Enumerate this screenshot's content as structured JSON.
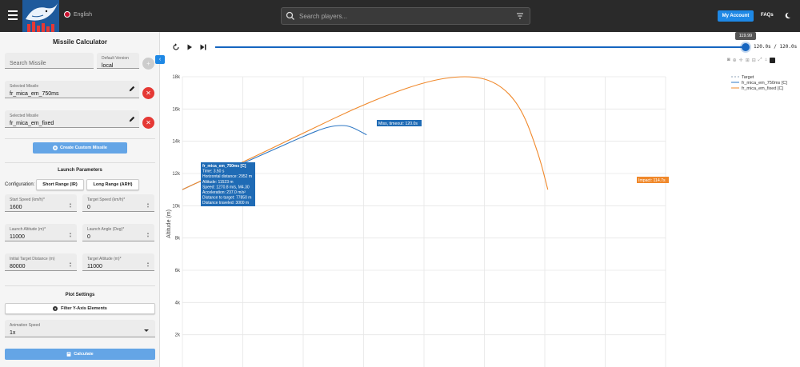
{
  "header": {
    "language": "English",
    "search_placeholder": "Search players...",
    "account_label": "My Account",
    "faqs_label": "FAQs",
    "icons": [
      "menu-icon",
      "flag-icon",
      "search-icon",
      "filter-icon",
      "moon-icon"
    ]
  },
  "sidebar": {
    "title": "Missile Calculator",
    "search_missile_placeholder": "Search Missile",
    "default_version_label": "Default Version",
    "default_version_value": "local",
    "selected_missile_label": "Selected Missile",
    "selected_missile_1": "fr_mica_em_750ms",
    "selected_missile_2": "fr_mica_em_fixed",
    "create_custom_label": "Create Custom Missile",
    "launch_params_title": "Launch Parameters",
    "configuration_label": "Configuration:",
    "short_range_label": "Short Range (IR)",
    "long_range_label": "Long Range (ARH)",
    "start_speed_label": "Start Speed (km/h)*",
    "start_speed_value": "1600",
    "target_speed_label": "Target Speed (km/h)*",
    "target_speed_value": "0",
    "launch_altitude_label": "Launch Altitude (m)*",
    "launch_altitude_value": "11000",
    "launch_angle_label": "Launch Angle (Deg)*",
    "launch_angle_value": "0",
    "initial_distance_label": "Initial Target Distance (m)",
    "initial_distance_value": "80000",
    "target_altitude_label": "Target Altitude (m)*",
    "target_altitude_value": "11000",
    "plot_settings_title": "Plot Settings",
    "filter_label": "Filter Y-Axis Elements",
    "animation_speed_label": "Animation Speed",
    "animation_speed_value": "1x",
    "calculate_label": "Calculate"
  },
  "player": {
    "tooltip": "119.99",
    "time_readout": "120.0s / 120.0s",
    "progress": 1.0
  },
  "chart_data": {
    "type": "line",
    "ylabel": "Altitude (m)",
    "xlabel": "",
    "ylim": [
      0,
      18000
    ],
    "xlim": [
      0,
      80000
    ],
    "y_ticks": [
      "2k",
      "4k",
      "6k",
      "8k",
      "10k",
      "12k",
      "14k",
      "16k",
      "18k"
    ],
    "y_tick_values": [
      2000,
      4000,
      6000,
      8000,
      10000,
      12000,
      14000,
      16000,
      18000
    ],
    "grid": true,
    "legend_position": "top-right",
    "series": [
      {
        "name": "Target",
        "color": "#8fa3b8",
        "dashed": true,
        "x": [],
        "y": []
      },
      {
        "name": "fr_mica_em_750ms [C]",
        "color": "#2f78c4",
        "x": [
          0,
          2952,
          8000,
          14000,
          20000,
          24000,
          26500,
          28000,
          30500
        ],
        "y": [
          11000,
          11523,
          12300,
          13300,
          14300,
          14900,
          15000,
          14900,
          14400
        ]
      },
      {
        "name": "fr_mica_em_fixed [C]",
        "color": "#f0882a",
        "x": [
          0,
          2952,
          10000,
          20000,
          30000,
          40000,
          47000,
          52000,
          56000,
          59000,
          60500
        ],
        "y": [
          11000,
          11523,
          12700,
          14500,
          16300,
          17700,
          18100,
          17700,
          16200,
          13200,
          11000
        ]
      }
    ],
    "annotations": {
      "hover_title": "fr_mica_em_750ms [C]",
      "hover_lines": [
        "Time: 3.50 s",
        "Horizontal distance: 2952 m",
        "Altitude: 11523 m",
        "Speed: 1270.8 m/s, M4.30",
        "Acceleration: 237.0 m/s²",
        "Distance to target: 77850 m",
        "Distance traveled: 3000 m"
      ],
      "miss_label": "Miss, timeout: 120.0s",
      "impact_label": "Impact: 114.7s"
    }
  }
}
